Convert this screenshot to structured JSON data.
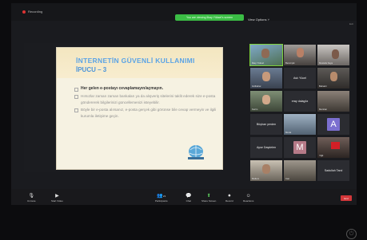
{
  "topbar": {
    "recording_label": "Recording",
    "share_banner": "You are viewing İlkay Yüksel's screen",
    "view_options_label": "View Options ˅",
    "exit_label": "Exit"
  },
  "slide": {
    "title": "İNTERNETİN GÜVENLİ KULLANIMI",
    "subtitle": "İPUCU – 3",
    "bullets": [
      "Her gelen e-postayı cevaplamayın/açmayın.",
      "Hırsızlar zaman zaman bankaları ya da alışveriş sitelerini taklit ederek size e-posta göndererek bilgilerinizi güncellemenizi isteyebilir.",
      "Böyle bir e-posta alırsanız, e-posta gerçek gibi görünse bile cevap vermeyin ve ilgili kurumla iletişime geçin."
    ]
  },
  "gallery": {
    "tiles": [
      {
        "name": "İlkay Yüksel",
        "type": "video"
      },
      {
        "name": "Berat işik",
        "type": "video"
      },
      {
        "name": "Mustafa Kaya",
        "type": "video"
      },
      {
        "name": "Gülbahar",
        "type": "video"
      },
      {
        "name": "Aslı Yücel",
        "type": "name"
      },
      {
        "name": "Bahadır",
        "type": "video"
      },
      {
        "name": "Kerim",
        "type": "video"
      },
      {
        "name": "eray dalagöz",
        "type": "name"
      },
      {
        "name": "Mertcan",
        "type": "video"
      },
      {
        "name": "Büşhan yerden",
        "type": "name"
      },
      {
        "name": "Murat",
        "type": "video"
      },
      {
        "name": "A",
        "type": "letter",
        "color": "#7b6fd0"
      },
      {
        "name": "Ayse Daşdelen",
        "type": "name"
      },
      {
        "name": "M",
        "type": "letter",
        "color": "#b57a88"
      },
      {
        "name": "Yiğit",
        "type": "video"
      },
      {
        "name": "Meltem",
        "type": "video"
      },
      {
        "name": "Can",
        "type": "video"
      },
      {
        "name": "Sadullah Tanıl",
        "type": "name"
      }
    ]
  },
  "toolbar": {
    "unmute": "Unmute",
    "start_video": "Start Video",
    "participants": "Participants",
    "participants_count": "21",
    "chat": "Chat",
    "share_screen": "Share Screen",
    "record": "Record",
    "reactions": "Reactions",
    "end": "End"
  },
  "icons": {
    "power": "power-icon"
  }
}
